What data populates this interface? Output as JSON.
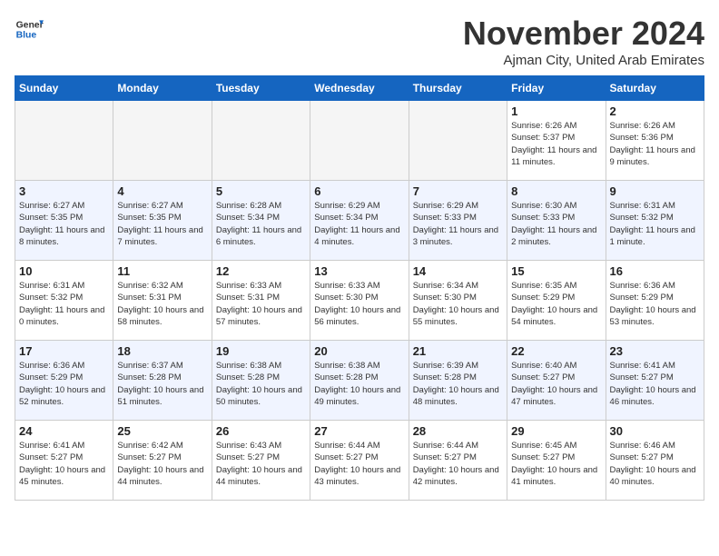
{
  "header": {
    "logo_general": "General",
    "logo_blue": "Blue",
    "month_title": "November 2024",
    "subtitle": "Ajman City, United Arab Emirates"
  },
  "weekdays": [
    "Sunday",
    "Monday",
    "Tuesday",
    "Wednesday",
    "Thursday",
    "Friday",
    "Saturday"
  ],
  "rows": [
    {
      "rowClass": "row-1",
      "days": [
        {
          "num": "",
          "info": "",
          "empty": true
        },
        {
          "num": "",
          "info": "",
          "empty": true
        },
        {
          "num": "",
          "info": "",
          "empty": true
        },
        {
          "num": "",
          "info": "",
          "empty": true
        },
        {
          "num": "",
          "info": "",
          "empty": true
        },
        {
          "num": "1",
          "info": "Sunrise: 6:26 AM\nSunset: 5:37 PM\nDaylight: 11 hours and 11 minutes.",
          "empty": false
        },
        {
          "num": "2",
          "info": "Sunrise: 6:26 AM\nSunset: 5:36 PM\nDaylight: 11 hours and 9 minutes.",
          "empty": false
        }
      ]
    },
    {
      "rowClass": "row-2",
      "days": [
        {
          "num": "3",
          "info": "Sunrise: 6:27 AM\nSunset: 5:35 PM\nDaylight: 11 hours and 8 minutes.",
          "empty": false
        },
        {
          "num": "4",
          "info": "Sunrise: 6:27 AM\nSunset: 5:35 PM\nDaylight: 11 hours and 7 minutes.",
          "empty": false
        },
        {
          "num": "5",
          "info": "Sunrise: 6:28 AM\nSunset: 5:34 PM\nDaylight: 11 hours and 6 minutes.",
          "empty": false
        },
        {
          "num": "6",
          "info": "Sunrise: 6:29 AM\nSunset: 5:34 PM\nDaylight: 11 hours and 4 minutes.",
          "empty": false
        },
        {
          "num": "7",
          "info": "Sunrise: 6:29 AM\nSunset: 5:33 PM\nDaylight: 11 hours and 3 minutes.",
          "empty": false
        },
        {
          "num": "8",
          "info": "Sunrise: 6:30 AM\nSunset: 5:33 PM\nDaylight: 11 hours and 2 minutes.",
          "empty": false
        },
        {
          "num": "9",
          "info": "Sunrise: 6:31 AM\nSunset: 5:32 PM\nDaylight: 11 hours and 1 minute.",
          "empty": false
        }
      ]
    },
    {
      "rowClass": "row-3",
      "days": [
        {
          "num": "10",
          "info": "Sunrise: 6:31 AM\nSunset: 5:32 PM\nDaylight: 11 hours and 0 minutes.",
          "empty": false
        },
        {
          "num": "11",
          "info": "Sunrise: 6:32 AM\nSunset: 5:31 PM\nDaylight: 10 hours and 58 minutes.",
          "empty": false
        },
        {
          "num": "12",
          "info": "Sunrise: 6:33 AM\nSunset: 5:31 PM\nDaylight: 10 hours and 57 minutes.",
          "empty": false
        },
        {
          "num": "13",
          "info": "Sunrise: 6:33 AM\nSunset: 5:30 PM\nDaylight: 10 hours and 56 minutes.",
          "empty": false
        },
        {
          "num": "14",
          "info": "Sunrise: 6:34 AM\nSunset: 5:30 PM\nDaylight: 10 hours and 55 minutes.",
          "empty": false
        },
        {
          "num": "15",
          "info": "Sunrise: 6:35 AM\nSunset: 5:29 PM\nDaylight: 10 hours and 54 minutes.",
          "empty": false
        },
        {
          "num": "16",
          "info": "Sunrise: 6:36 AM\nSunset: 5:29 PM\nDaylight: 10 hours and 53 minutes.",
          "empty": false
        }
      ]
    },
    {
      "rowClass": "row-4",
      "days": [
        {
          "num": "17",
          "info": "Sunrise: 6:36 AM\nSunset: 5:29 PM\nDaylight: 10 hours and 52 minutes.",
          "empty": false
        },
        {
          "num": "18",
          "info": "Sunrise: 6:37 AM\nSunset: 5:28 PM\nDaylight: 10 hours and 51 minutes.",
          "empty": false
        },
        {
          "num": "19",
          "info": "Sunrise: 6:38 AM\nSunset: 5:28 PM\nDaylight: 10 hours and 50 minutes.",
          "empty": false
        },
        {
          "num": "20",
          "info": "Sunrise: 6:38 AM\nSunset: 5:28 PM\nDaylight: 10 hours and 49 minutes.",
          "empty": false
        },
        {
          "num": "21",
          "info": "Sunrise: 6:39 AM\nSunset: 5:28 PM\nDaylight: 10 hours and 48 minutes.",
          "empty": false
        },
        {
          "num": "22",
          "info": "Sunrise: 6:40 AM\nSunset: 5:27 PM\nDaylight: 10 hours and 47 minutes.",
          "empty": false
        },
        {
          "num": "23",
          "info": "Sunrise: 6:41 AM\nSunset: 5:27 PM\nDaylight: 10 hours and 46 minutes.",
          "empty": false
        }
      ]
    },
    {
      "rowClass": "row-5",
      "days": [
        {
          "num": "24",
          "info": "Sunrise: 6:41 AM\nSunset: 5:27 PM\nDaylight: 10 hours and 45 minutes.",
          "empty": false
        },
        {
          "num": "25",
          "info": "Sunrise: 6:42 AM\nSunset: 5:27 PM\nDaylight: 10 hours and 44 minutes.",
          "empty": false
        },
        {
          "num": "26",
          "info": "Sunrise: 6:43 AM\nSunset: 5:27 PM\nDaylight: 10 hours and 44 minutes.",
          "empty": false
        },
        {
          "num": "27",
          "info": "Sunrise: 6:44 AM\nSunset: 5:27 PM\nDaylight: 10 hours and 43 minutes.",
          "empty": false
        },
        {
          "num": "28",
          "info": "Sunrise: 6:44 AM\nSunset: 5:27 PM\nDaylight: 10 hours and 42 minutes.",
          "empty": false
        },
        {
          "num": "29",
          "info": "Sunrise: 6:45 AM\nSunset: 5:27 PM\nDaylight: 10 hours and 41 minutes.",
          "empty": false
        },
        {
          "num": "30",
          "info": "Sunrise: 6:46 AM\nSunset: 5:27 PM\nDaylight: 10 hours and 40 minutes.",
          "empty": false
        }
      ]
    }
  ]
}
